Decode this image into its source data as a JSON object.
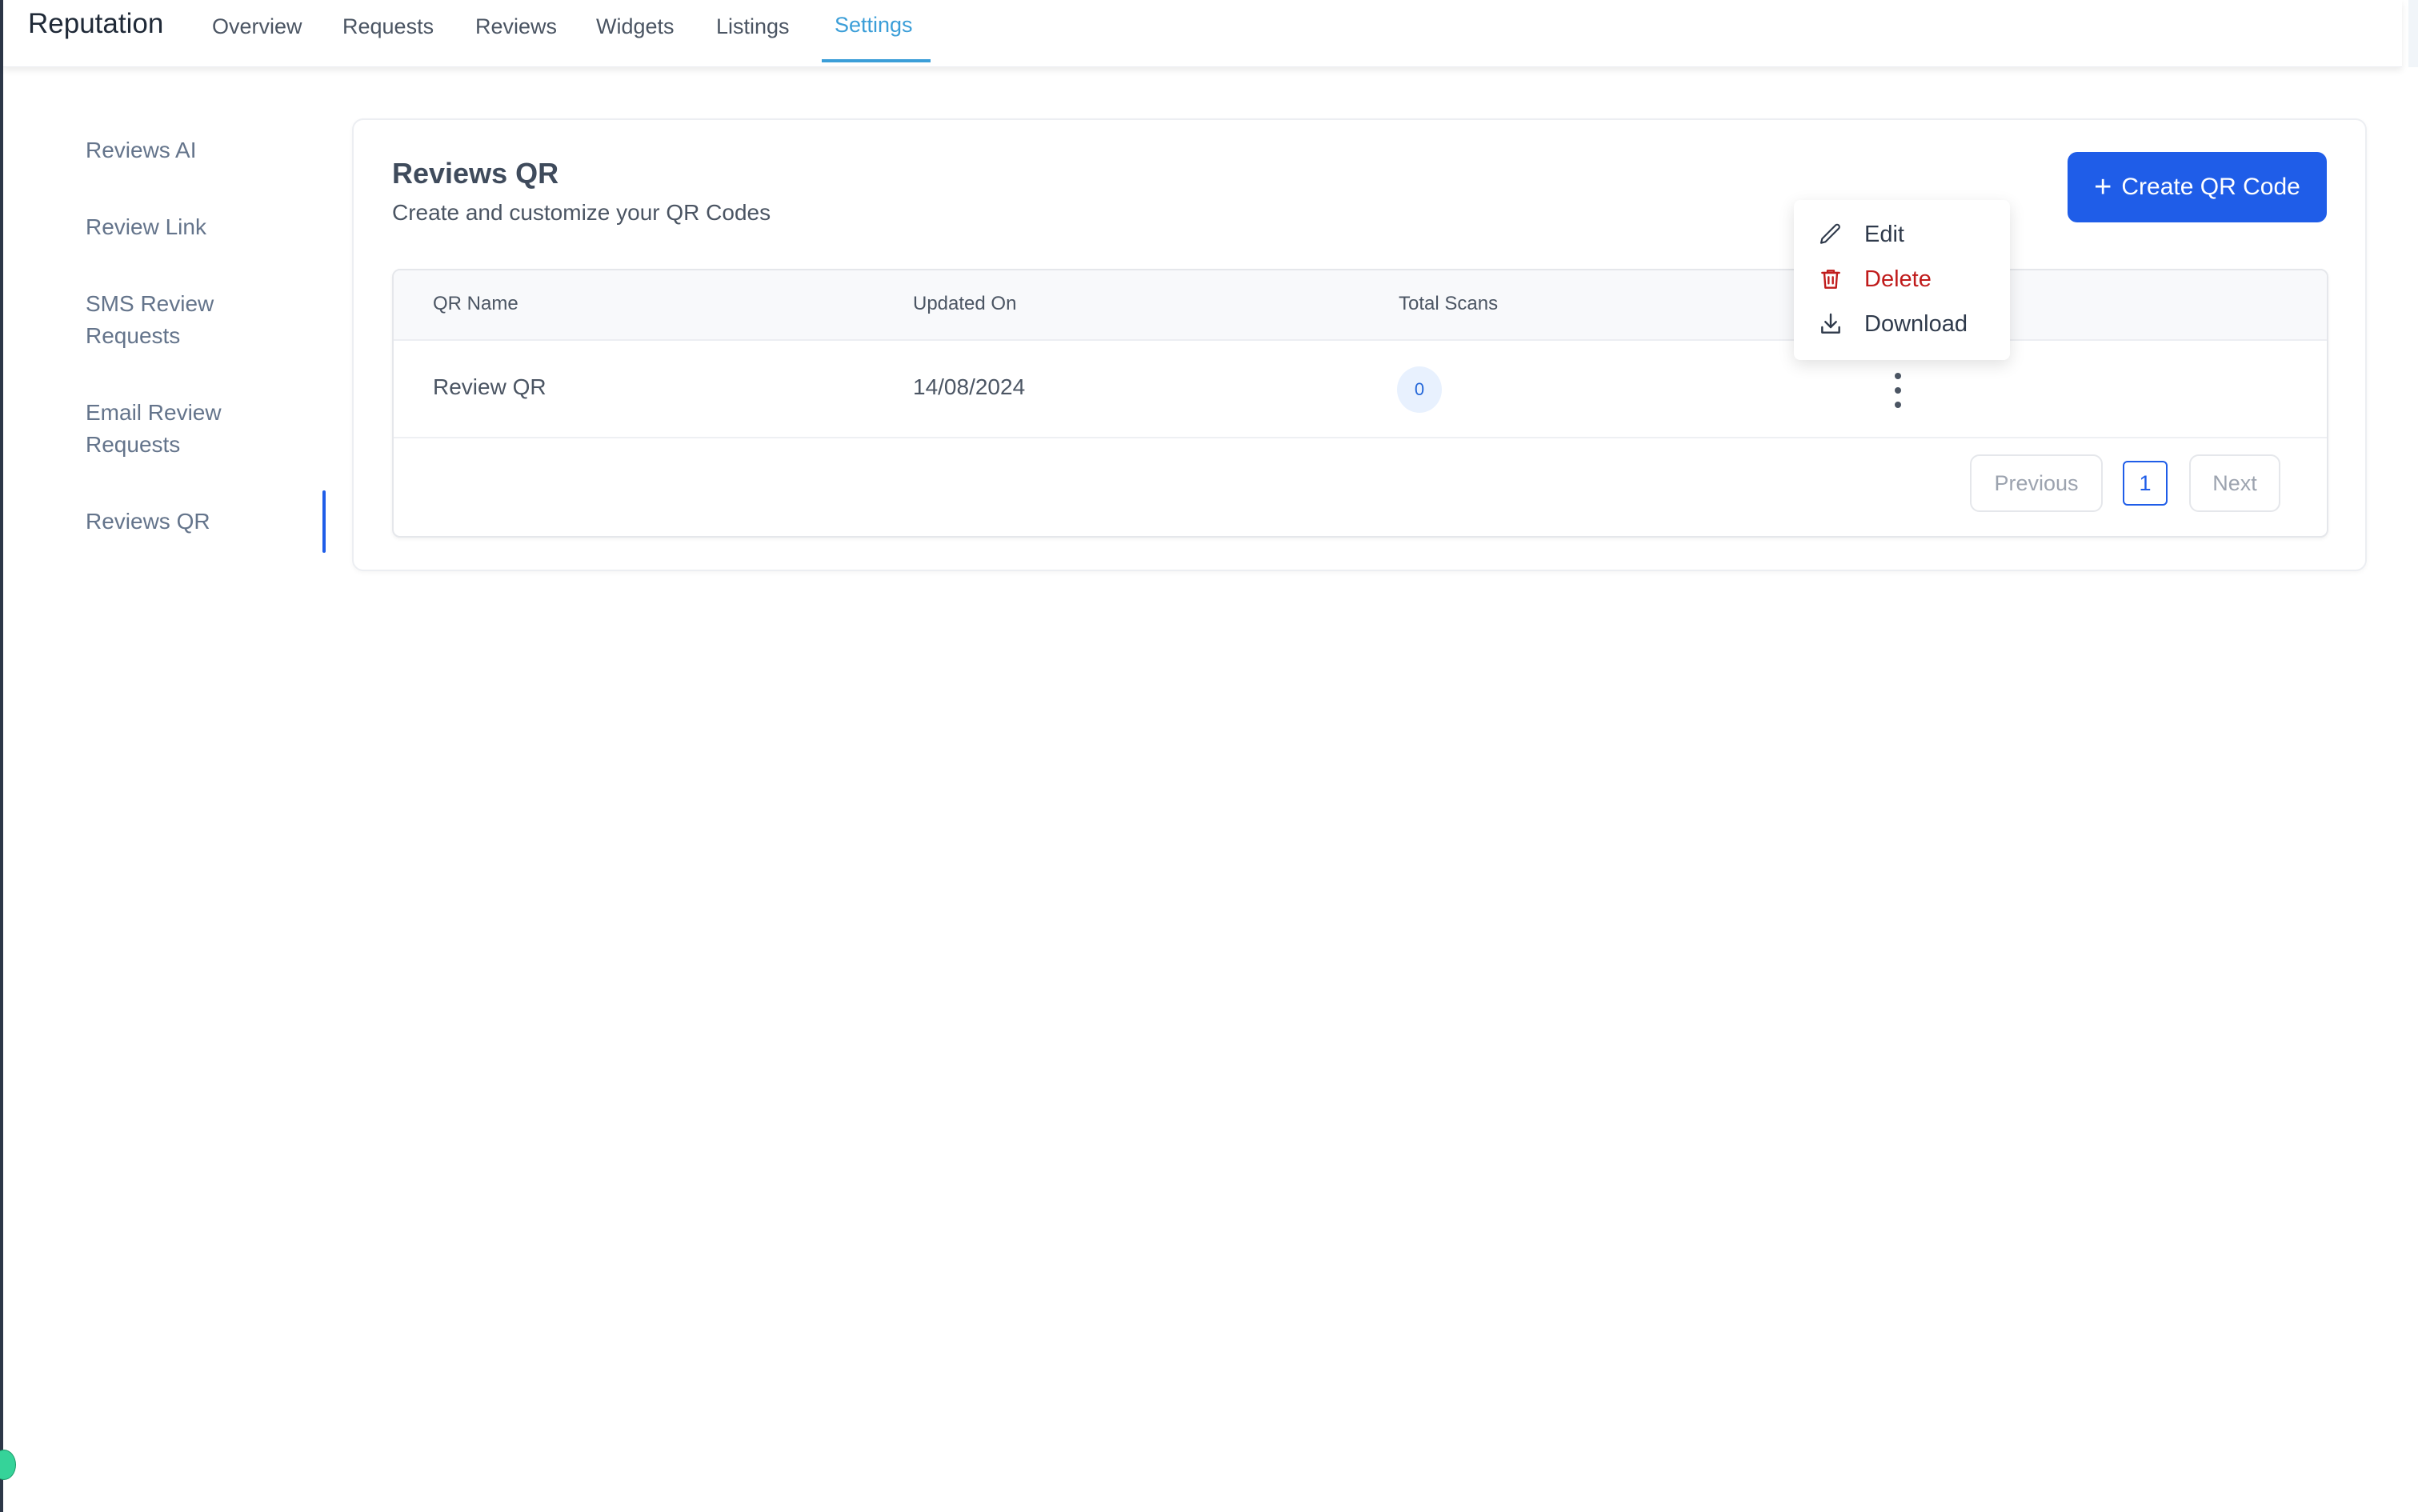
{
  "header": {
    "brand": "Reputation",
    "tabs": [
      {
        "label": "Overview",
        "active": false
      },
      {
        "label": "Requests",
        "active": false
      },
      {
        "label": "Reviews",
        "active": false
      },
      {
        "label": "Widgets",
        "active": false
      },
      {
        "label": "Listings",
        "active": false
      },
      {
        "label": "Settings",
        "active": true
      }
    ]
  },
  "sidebar": {
    "items": [
      {
        "label": "Reviews AI",
        "active": false
      },
      {
        "label": "Review Link",
        "active": false
      },
      {
        "label": "SMS Review Requests",
        "active": false
      },
      {
        "label": "Email Review Requests",
        "active": false
      },
      {
        "label": "Reviews QR",
        "active": true
      }
    ]
  },
  "main": {
    "title": "Reviews QR",
    "subtitle": "Create and customize your QR Codes",
    "create_button": {
      "icon": "plus-icon",
      "label": "Create QR Code"
    },
    "table": {
      "columns": [
        "QR Name",
        "Updated On",
        "Total Scans"
      ],
      "rows": [
        {
          "name": "Review QR",
          "updated_on": "14/08/2024",
          "total_scans": "0",
          "actions_icon": "kebab-menu-icon"
        }
      ]
    },
    "pagination": {
      "previous_label": "Previous",
      "current_page": "1",
      "next_label": "Next"
    },
    "row_menu": {
      "items": [
        {
          "icon": "pencil-icon",
          "label": "Edit",
          "tone": "default"
        },
        {
          "icon": "trash-icon",
          "label": "Delete",
          "tone": "danger"
        },
        {
          "icon": "download-icon",
          "label": "Download",
          "tone": "default"
        }
      ]
    }
  },
  "colors": {
    "accent": "#1f5de8",
    "tab_active": "#3b9ed8",
    "danger": "#c01c1c",
    "badge_bg": "#e8f1fe"
  }
}
